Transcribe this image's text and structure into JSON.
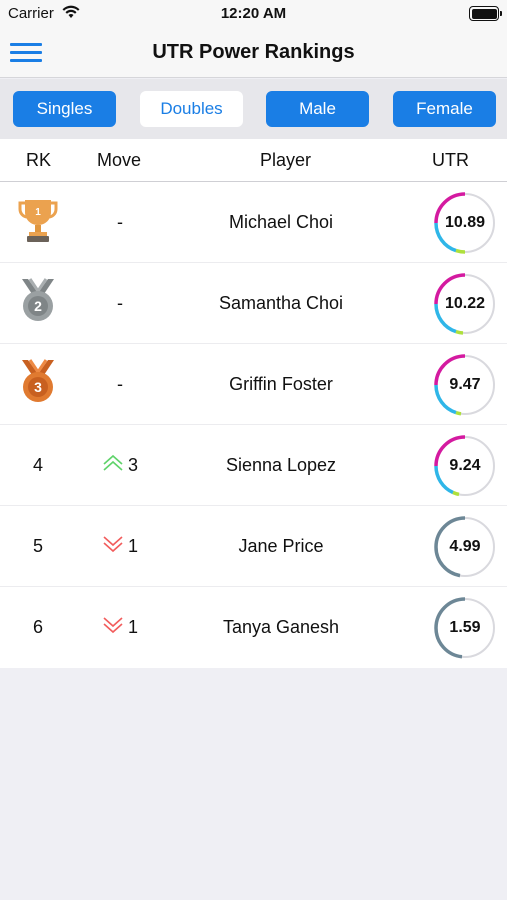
{
  "status": {
    "carrier": "Carrier",
    "time": "12:20 AM"
  },
  "nav": {
    "title": "UTR Power Rankings",
    "menu_icon": "hamburger-menu-icon"
  },
  "filters": [
    {
      "label": "Singles",
      "active": false
    },
    {
      "label": "Doubles",
      "active": true
    },
    {
      "label": "Male",
      "active": false
    },
    {
      "label": "Female",
      "active": false
    }
  ],
  "table": {
    "headers": {
      "rank": "RK",
      "move": "Move",
      "player": "Player",
      "utr": "UTR"
    },
    "rows": [
      {
        "rank": "",
        "rank_icon": "gold-trophy-icon",
        "move": "-",
        "move_dir": "none",
        "player": "Michael Choi",
        "utr": "10.89",
        "ring": "color"
      },
      {
        "rank": "",
        "rank_icon": "silver-medal-icon",
        "move": "-",
        "move_dir": "none",
        "player": "Samantha Choi",
        "utr": "10.22",
        "ring": "color"
      },
      {
        "rank": "",
        "rank_icon": "bronze-medal-icon",
        "move": "-",
        "move_dir": "none",
        "player": "Griffin Foster",
        "utr": "9.47",
        "ring": "color"
      },
      {
        "rank": "4",
        "move": "3",
        "move_dir": "up",
        "player": "Sienna Lopez",
        "utr": "9.24",
        "ring": "color"
      },
      {
        "rank": "5",
        "move": "1",
        "move_dir": "down",
        "player": "Jane Price",
        "utr": "4.99",
        "ring": "gray"
      },
      {
        "rank": "6",
        "move": "1",
        "move_dir": "down",
        "player": "Tanya Ganesh",
        "utr": "1.59",
        "ring": "gray"
      }
    ]
  },
  "colors": {
    "accent": "#1a7ee5",
    "up": "#4cd964",
    "down": "#ff3b30",
    "gray_ring": "#6d8796",
    "gold": "#e6a04a",
    "silver": "#8f9496",
    "bronze": "#d9712a"
  }
}
